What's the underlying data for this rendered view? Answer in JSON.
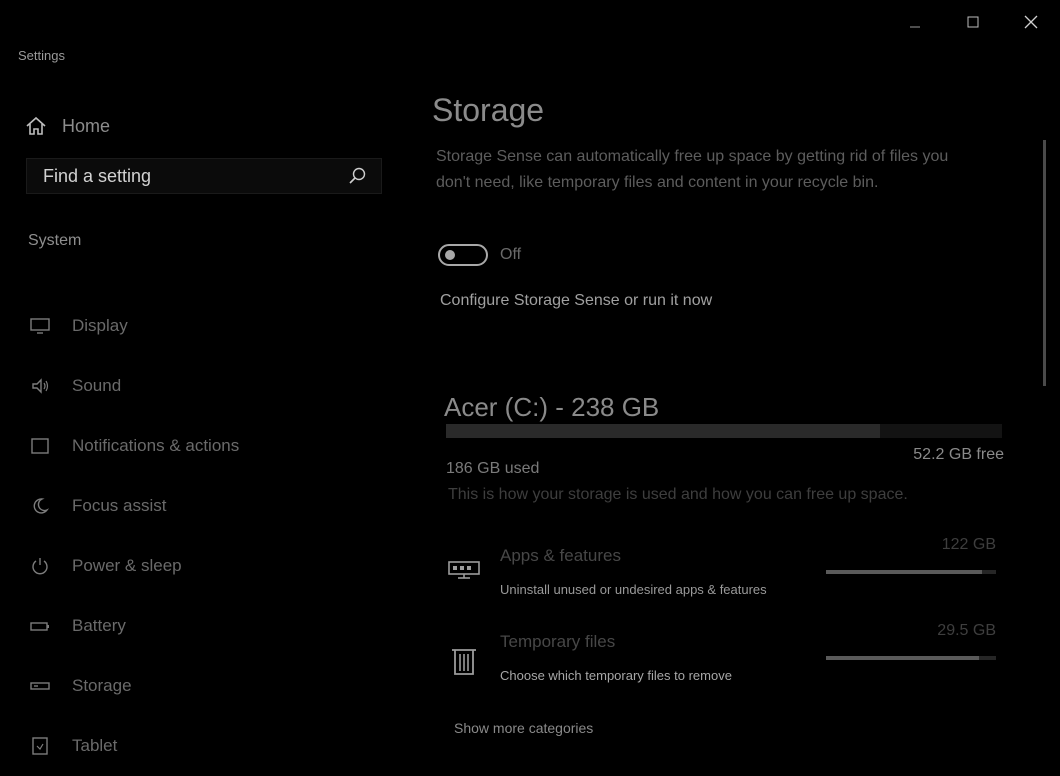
{
  "window": {
    "title": "Settings"
  },
  "sidebar": {
    "home_label": "Home",
    "search_placeholder": "Find a setting",
    "section_label": "System",
    "items": [
      {
        "label": "Display",
        "icon": "monitor-icon"
      },
      {
        "label": "Sound",
        "icon": "speaker-icon"
      },
      {
        "label": "Notifications & actions",
        "icon": "notification-icon"
      },
      {
        "label": "Focus assist",
        "icon": "moon-icon"
      },
      {
        "label": "Power & sleep",
        "icon": "power-icon"
      },
      {
        "label": "Battery",
        "icon": "battery-icon"
      },
      {
        "label": "Storage",
        "icon": "storage-icon"
      },
      {
        "label": "Tablet",
        "icon": "tablet-icon"
      }
    ]
  },
  "main": {
    "title": "Storage",
    "description": "Storage Sense can automatically free up space by getting rid of files you don't need, like temporary files and content in your recycle bin.",
    "toggle_state": "Off",
    "configure_link": "Configure Storage Sense or run it now",
    "drive": {
      "title": "Acer (C:) - 238 GB",
      "used": "186 GB used",
      "free": "52.2 GB free",
      "used_fraction": 0.78,
      "help": "This is how your storage is used and how you can free up space."
    },
    "categories": [
      {
        "name": "Apps & features",
        "size": "122 GB",
        "sub": "Uninstall unused or undesired apps & features",
        "fill": 0.92,
        "icon": "apps-icon"
      },
      {
        "name": "Temporary files",
        "size": "29.5 GB",
        "sub": "Choose which temporary files to remove",
        "fill": 0.9,
        "icon": "trash-icon"
      }
    ],
    "more_link": "Show more categories"
  }
}
